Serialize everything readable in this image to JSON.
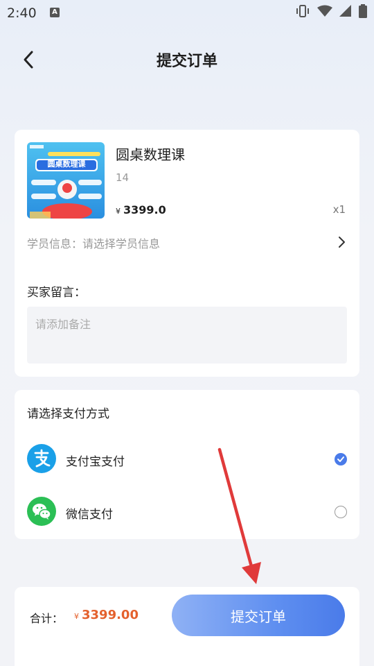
{
  "status_bar": {
    "time": "2:40",
    "notification_letter": "A",
    "icons": [
      "vibrate-icon",
      "wifi-icon",
      "signal-icon",
      "battery-icon"
    ]
  },
  "nav": {
    "back_icon": "chevron-left-icon",
    "title": "提交订单"
  },
  "order": {
    "thumbnail_text": "圆桌数理课",
    "product_title": "圆桌数理课",
    "product_sub": "14",
    "currency": "¥",
    "price": "3399.0",
    "quantity": "x1",
    "student_info_label": "学员信息：请选择学员信息",
    "remark_label": "买家留言：",
    "remark_placeholder": "请添加备注"
  },
  "payment": {
    "title": "请选择支付方式",
    "methods": [
      {
        "label": "支付宝支付",
        "icon": "alipay-icon",
        "color": "#1aa0e8",
        "selected": true
      },
      {
        "label": "微信支付",
        "icon": "wechat-icon",
        "color": "#2bbf55",
        "selected": false
      }
    ]
  },
  "footer": {
    "total_label": "合计：",
    "currency": "¥",
    "total_amount": "3399.00",
    "submit_label": "提交订单"
  },
  "colors": {
    "accent": "#4a7be9",
    "price": "#e4612d",
    "annotation_arrow": "#e03a3a"
  }
}
